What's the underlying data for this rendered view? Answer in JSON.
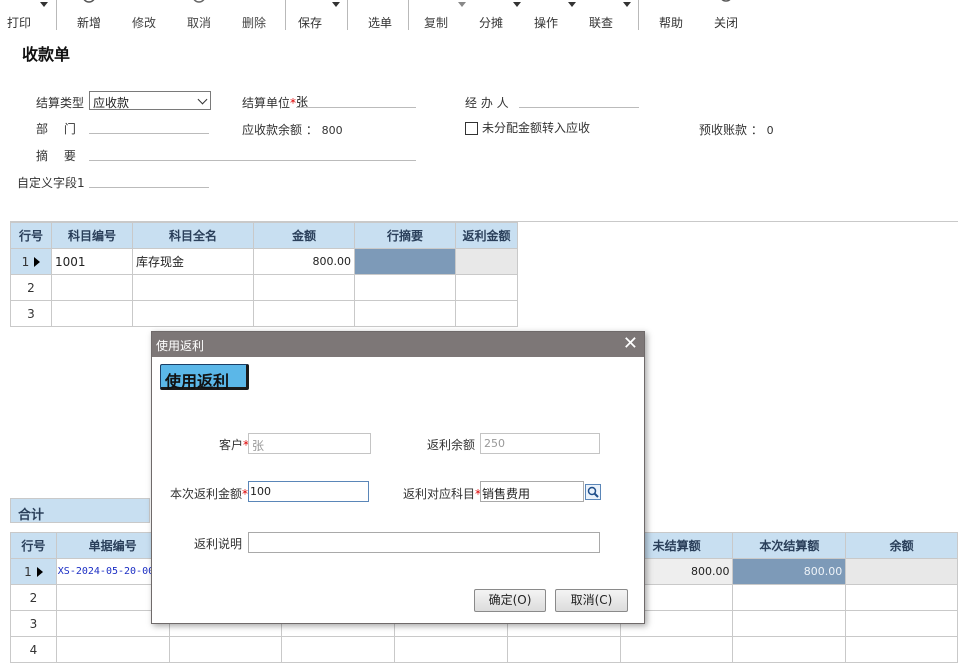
{
  "toolbar": {
    "items": [
      {
        "label": "打印",
        "icon": "print-icon"
      },
      {
        "label": "新增",
        "icon": "add-icon"
      },
      {
        "label": "修改",
        "icon": "edit-icon"
      },
      {
        "label": "取消",
        "icon": "cancel-icon"
      },
      {
        "label": "删除",
        "icon": "delete-icon"
      },
      {
        "label": "保存",
        "icon": "save-icon"
      },
      {
        "label": "选单",
        "icon": "select-icon"
      },
      {
        "label": "复制",
        "icon": "copy-icon"
      },
      {
        "label": "分摊",
        "icon": "allocate-icon"
      },
      {
        "label": "操作",
        "icon": "operation-icon"
      },
      {
        "label": "联查",
        "icon": "query-icon"
      },
      {
        "label": "帮助",
        "icon": "help-icon"
      },
      {
        "label": "关闭",
        "icon": "close-icon"
      }
    ]
  },
  "form": {
    "title": "收款单",
    "settle_type_label": "结算类型",
    "settle_type_value": "应收款",
    "settle_unit_label": "结算单位",
    "settle_unit_value": "张",
    "handler_label": "经 办 人",
    "dept_label": "部　 门",
    "receivable_balance_label": "应收款余额 ：",
    "receivable_balance_value": "800",
    "unassigned_label": "未分配金额转入应收",
    "prepaid_label": "预收账款 ：",
    "prepaid_value": "0",
    "summary_label": "摘　 要",
    "custom_label": "自定义字段1"
  },
  "grid1": {
    "headers": [
      "行号",
      "科目编号",
      "科目全名",
      "金额",
      "行摘要",
      "返利金额"
    ],
    "rows": [
      {
        "no": "1",
        "code": "1001",
        "name": "库存现金",
        "amount": "800.00"
      },
      {
        "no": "2",
        "code": "",
        "name": "",
        "amount": ""
      },
      {
        "no": "3",
        "code": "",
        "name": "",
        "amount": ""
      }
    ],
    "total_label": "合计"
  },
  "grid2": {
    "headers": [
      "行号",
      "单据编号",
      "",
      "",
      "",
      "",
      "未结算额",
      "本次结算额",
      "余额"
    ],
    "rows": [
      {
        "no": "1",
        "doc": "XS-2024-05-20-00",
        "unsettled": "800.00",
        "settle": "800.00"
      },
      {
        "no": "2",
        "doc": "",
        "unsettled": "",
        "settle": ""
      },
      {
        "no": "3",
        "doc": "",
        "unsettled": "",
        "settle": ""
      },
      {
        "no": "4",
        "doc": "",
        "unsettled": "",
        "settle": ""
      }
    ]
  },
  "dialog": {
    "title": "使用返利",
    "banner": "使用返利",
    "customer_label": "客户",
    "customer_value": "张",
    "rebate_balance_label": "返利余额",
    "rebate_balance_value": "250",
    "rebate_amount_label": "本次返利金额",
    "rebate_amount_value": "100",
    "rebate_account_label": "返利对应科目",
    "rebate_account_value": "销售费用",
    "rebate_note_label": "返利说明",
    "rebate_note_value": "",
    "ok_label": "确定(O)",
    "cancel_label": "取消(C)",
    "required_mark": "*"
  }
}
